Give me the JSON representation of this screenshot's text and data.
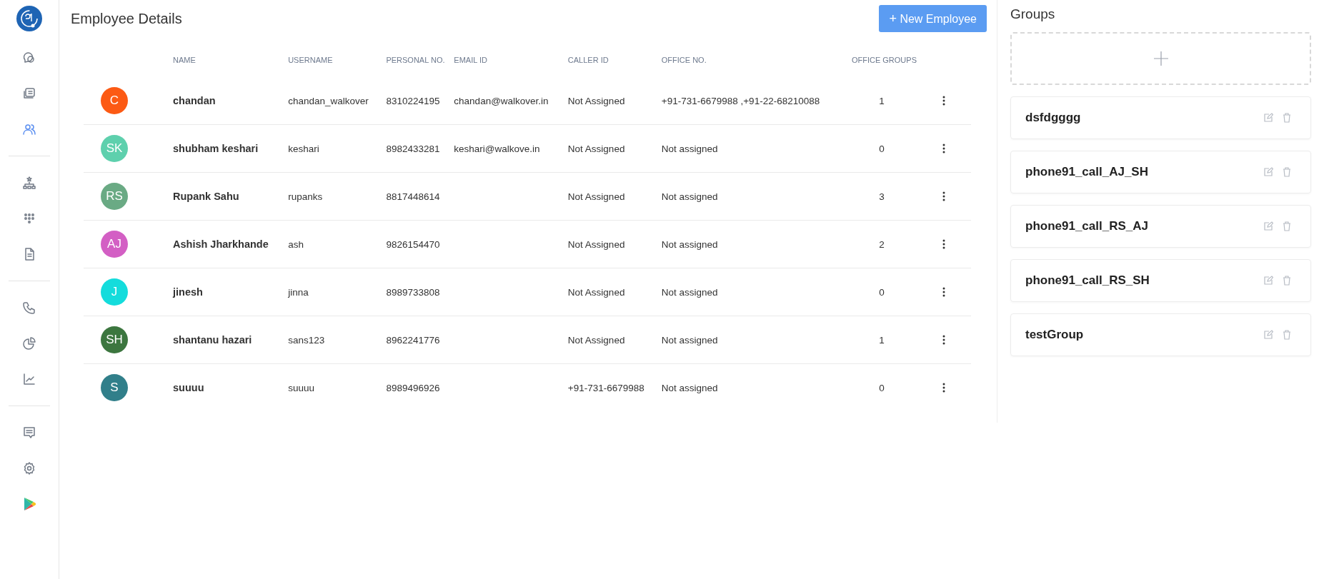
{
  "sidebar": {
    "sections": [
      {
        "items": [
          {
            "selected": false
          },
          {
            "selected": false
          },
          {
            "selected": true
          }
        ]
      },
      {
        "items": [
          {
            "selected": false
          },
          {
            "selected": false
          },
          {
            "selected": false
          }
        ]
      },
      {
        "items": [
          {
            "selected": false
          },
          {
            "selected": false
          },
          {
            "selected": false
          }
        ]
      },
      {
        "items": [
          {
            "selected": false
          },
          {
            "selected": false
          },
          {
            "selected": false
          }
        ]
      }
    ]
  },
  "header": {
    "title": "Employee Details",
    "button": {
      "icon": "+",
      "label": "New Employee"
    }
  },
  "table": {
    "columns": [
      "NAME",
      "USERNAME",
      "PERSONAL NO.",
      "EMAIL ID",
      "CALLER ID",
      "OFFICE NO.",
      "OFFICE GROUPS"
    ],
    "rows": [
      {
        "initials": "C",
        "color": "#fc5a14",
        "name": "chandan",
        "username": "chandan_walkover",
        "personal_no": "8310224195",
        "email": "chandan@walkover.in",
        "caller_id": "Not Assigned",
        "office_no": "+91-731-6679988 ,+91-22-68210088",
        "office_groups": "1"
      },
      {
        "initials": "SK",
        "color": "#5ed0ad",
        "name": "shubham keshari",
        "username": "keshari",
        "personal_no": "8982433281",
        "email": "keshari@walkove.in",
        "caller_id": "Not Assigned",
        "office_no": "Not assigned",
        "office_groups": "0"
      },
      {
        "initials": "RS",
        "color": "#6aaa84",
        "name": "Rupank Sahu",
        "username": "rupanks",
        "personal_no": "8817448614",
        "email": "",
        "caller_id": "Not Assigned",
        "office_no": "Not assigned",
        "office_groups": "3"
      },
      {
        "initials": "AJ",
        "color": "#d35fc4",
        "name": "Ashish Jharkhande",
        "username": "ash",
        "personal_no": "9826154470",
        "email": "",
        "caller_id": "Not Assigned",
        "office_no": "Not assigned",
        "office_groups": "2"
      },
      {
        "initials": "J",
        "color": "#14dcdc",
        "name": "jinesh",
        "username": "jinna",
        "personal_no": "8989733808",
        "email": "",
        "caller_id": "Not Assigned",
        "office_no": "Not assigned",
        "office_groups": "0"
      },
      {
        "initials": "SH",
        "color": "#3c763f",
        "name": "shantanu hazari",
        "username": "sans123",
        "personal_no": "8962241776",
        "email": "",
        "caller_id": "Not Assigned",
        "office_no": "Not assigned",
        "office_groups": "1"
      },
      {
        "initials": "S",
        "color": "#317f8a",
        "name": "suuuu",
        "username": "suuuu",
        "personal_no": "8989496926",
        "email": "",
        "caller_id": "+91-731-6679988",
        "office_no": "Not assigned",
        "office_groups": "0"
      }
    ]
  },
  "groups": {
    "title": "Groups",
    "items": [
      "dsfdgggg",
      "phone91_call_AJ_SH",
      "phone91_call_RS_AJ",
      "phone91_call_RS_SH",
      "testGroup"
    ]
  }
}
